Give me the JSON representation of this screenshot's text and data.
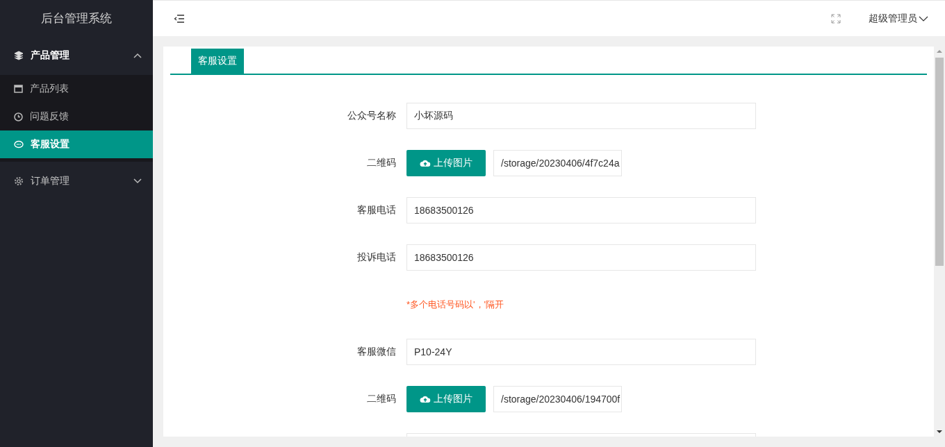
{
  "sidebar": {
    "title": "后台管理系统",
    "groups": [
      {
        "label": "产品管理",
        "expanded": true,
        "children": [
          {
            "label": "产品列表",
            "selected": false
          },
          {
            "label": "问题反馈",
            "selected": false
          },
          {
            "label": "客服设置",
            "selected": true
          }
        ]
      },
      {
        "label": "订单管理",
        "expanded": false
      }
    ]
  },
  "header": {
    "user": "超级管理员"
  },
  "tabs": [
    {
      "label": "客服设置",
      "selected": true
    }
  ],
  "form": [
    {
      "kind": "text",
      "label": "公众号名称",
      "value": "小坏源码"
    },
    {
      "kind": "upload",
      "label": "二维码",
      "button": "上传图片",
      "value": "/storage/20230406/4f7c24a"
    },
    {
      "kind": "text",
      "label": "客服电话",
      "value": "18683500126"
    },
    {
      "kind": "text",
      "label": "投诉电话",
      "value": "18683500126"
    },
    {
      "kind": "note",
      "text": "*多个电话号码以'，'隔开"
    },
    {
      "kind": "text",
      "label": "客服微信",
      "value": "P10-24Y"
    },
    {
      "kind": "upload",
      "label": "二维码",
      "button": "上传图片",
      "value": "/storage/20230406/194700f"
    },
    {
      "kind": "blank"
    }
  ]
}
